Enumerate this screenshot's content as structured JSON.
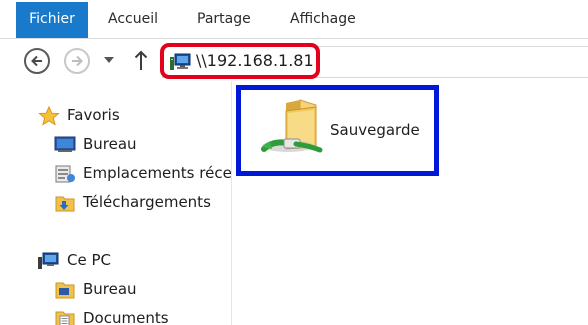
{
  "ribbon": {
    "tabs": [
      {
        "label": "Fichier"
      },
      {
        "label": "Accueil"
      },
      {
        "label": "Partage"
      },
      {
        "label": "Affichage"
      }
    ]
  },
  "address_bar": {
    "path": "\\\\192.168.1.81"
  },
  "navigation_pane": {
    "items": [
      {
        "label": "Favoris",
        "icon": "star-icon"
      },
      {
        "label": "Bureau",
        "icon": "desktop-icon"
      },
      {
        "label": "Emplacements récer",
        "icon": "recent-places-icon"
      },
      {
        "label": "Téléchargements",
        "icon": "downloads-folder-icon"
      },
      {
        "label": "Ce PC",
        "icon": "computer-icon"
      },
      {
        "label": "Bureau",
        "icon": "desktop-folder-icon"
      },
      {
        "label": "Documents",
        "icon": "documents-icon"
      }
    ]
  },
  "content": {
    "items": [
      {
        "label": "Sauvegarde",
        "icon": "shared-folder-icon"
      }
    ]
  },
  "colors": {
    "file_tab": "#1979ca",
    "address_highlight": "#e3001b",
    "selection_highlight": "#0018d8"
  }
}
